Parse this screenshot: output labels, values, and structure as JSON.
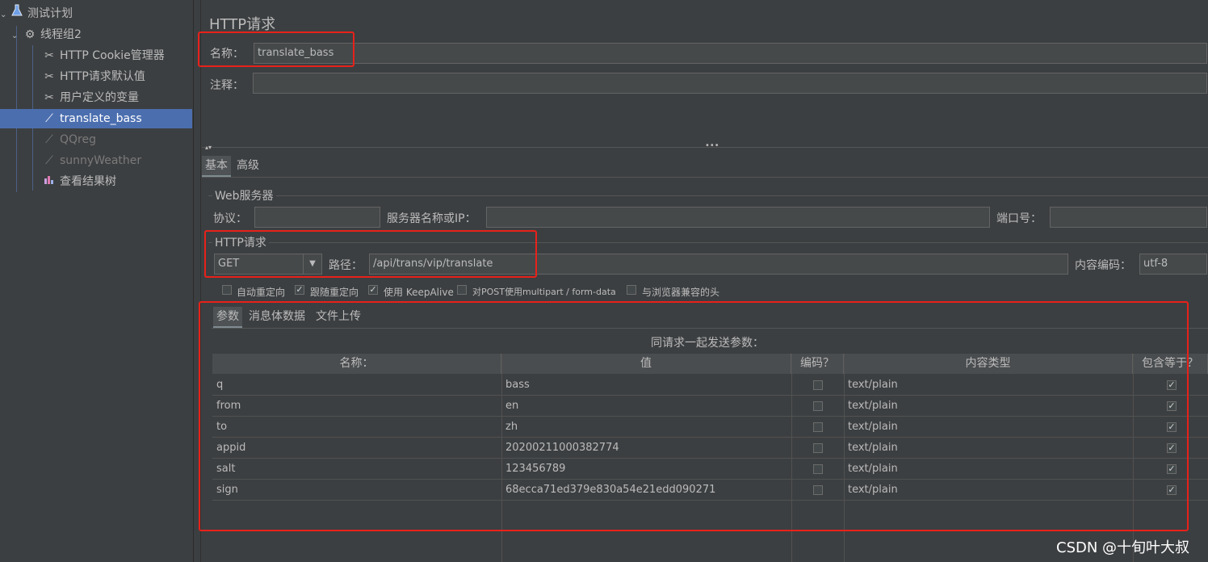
{
  "tree": {
    "items": [
      {
        "label": "测试计划",
        "icon": "test-plan-flask-icon"
      },
      {
        "label": "线程组2",
        "icon": "gear-icon"
      },
      {
        "label": "HTTP Cookie管理器",
        "icon": "wrench-scissors-icon"
      },
      {
        "label": "HTTP请求默认值",
        "icon": "wrench-scissors-icon"
      },
      {
        "label": "用户定义的变量",
        "icon": "wrench-scissors-icon"
      },
      {
        "label": "translate_bass",
        "icon": "pipette-icon"
      },
      {
        "label": "QQreg",
        "icon": "pipette-icon"
      },
      {
        "label": "sunnyWeather",
        "icon": "pipette-icon"
      },
      {
        "label": "查看结果树",
        "icon": "chart-icon"
      }
    ]
  },
  "panel": {
    "title": "HTTP请求",
    "name_label": "名称：",
    "name_value": "translate_bass",
    "comment_label": "注释：",
    "comment_value": ""
  },
  "tabs": {
    "basic": "基本",
    "advanced": "高级"
  },
  "web_server": {
    "section": "Web服务器",
    "protocol_label": "协议：",
    "protocol_value": "",
    "server_label": "服务器名称或IP：",
    "server_value": "",
    "port_label": "端口号：",
    "port_value": ""
  },
  "http_request": {
    "section": "HTTP请求",
    "method": "GET",
    "path_label": "路径：",
    "path_value": "/api/trans/vip/translate",
    "encoding_label": "内容编码：",
    "encoding_value": "utf-8"
  },
  "options": [
    {
      "label": "自动重定向",
      "checked": false
    },
    {
      "label": "跟随重定向",
      "checked": true
    },
    {
      "label": "使用 KeepAlive",
      "checked": true
    },
    {
      "label": "对POST使用multipart / form-data",
      "checked": false
    },
    {
      "label": "与浏览器兼容的头",
      "checked": false
    }
  ],
  "subtabs": {
    "params": "参数",
    "body": "消息体数据",
    "files": "文件上传"
  },
  "params": {
    "caption": "同请求一起发送参数：",
    "headers": [
      "名称：",
      "值",
      "编码？",
      "内容类型",
      "包含等于？"
    ],
    "rows": [
      {
        "name": "q",
        "value": "bass",
        "encode": false,
        "type": "text/plain",
        "include": true
      },
      {
        "name": "from",
        "value": "en",
        "encode": false,
        "type": "text/plain",
        "include": true
      },
      {
        "name": "to",
        "value": "zh",
        "encode": false,
        "type": "text/plain",
        "include": true
      },
      {
        "name": "appid",
        "value": "20200211000382774",
        "encode": false,
        "type": "text/plain",
        "include": true
      },
      {
        "name": "salt",
        "value": "123456789",
        "encode": false,
        "type": "text/plain",
        "include": true
      },
      {
        "name": "sign",
        "value": "68ecca71ed379e830a54e21edd090271",
        "encode": false,
        "type": "text/plain",
        "include": true
      }
    ]
  },
  "watermark": "CSDN @十旬叶大叔",
  "colors": {
    "selection": "#4b6eaf",
    "annotation_red": "#e8211a"
  }
}
